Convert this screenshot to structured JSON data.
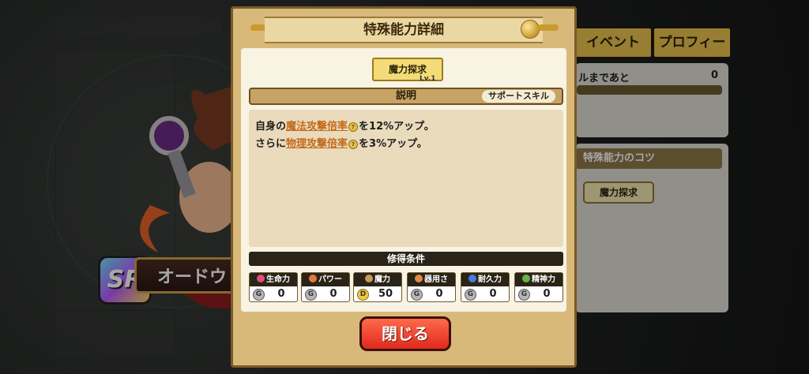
{
  "dialog": {
    "title": "特殊能力詳細",
    "skill_name": "魔力探求",
    "level": "Lv.1",
    "description_label": "説明",
    "support_tag": "サポートスキル",
    "description": {
      "line1": {
        "pre": "自身の",
        "term": "魔法攻撃倍率",
        "post": "を12%アップ。"
      },
      "line2": {
        "pre": "さらに",
        "term": "物理攻撃倍率",
        "post": "を3%アップ。"
      }
    },
    "conditions_label": "修得条件",
    "stats": [
      {
        "label": "生命力",
        "rank": "G",
        "value": "0",
        "icon_color": "#e0507a"
      },
      {
        "label": "パワー",
        "rank": "G",
        "value": "0",
        "icon_color": "#e07a3a"
      },
      {
        "label": "魔力",
        "rank": "D",
        "value": "50",
        "icon_color": "#c99a5a"
      },
      {
        "label": "器用さ",
        "rank": "G",
        "value": "0",
        "icon_color": "#e08a4a"
      },
      {
        "label": "耐久力",
        "rank": "G",
        "value": "0",
        "icon_color": "#4a7ae0"
      },
      {
        "label": "精神力",
        "rank": "G",
        "value": "0",
        "icon_color": "#6ab04a"
      }
    ],
    "close_label": "閉じる"
  },
  "background": {
    "tabs": {
      "event": "イベント",
      "profile": "プロフィール"
    },
    "remaining_text": "ルまであと",
    "remaining_value": "0",
    "tips_title": "特殊能力のコツ",
    "tips_button": "魔力探求",
    "card_rarity": "SR",
    "card_name": "オードウ"
  }
}
